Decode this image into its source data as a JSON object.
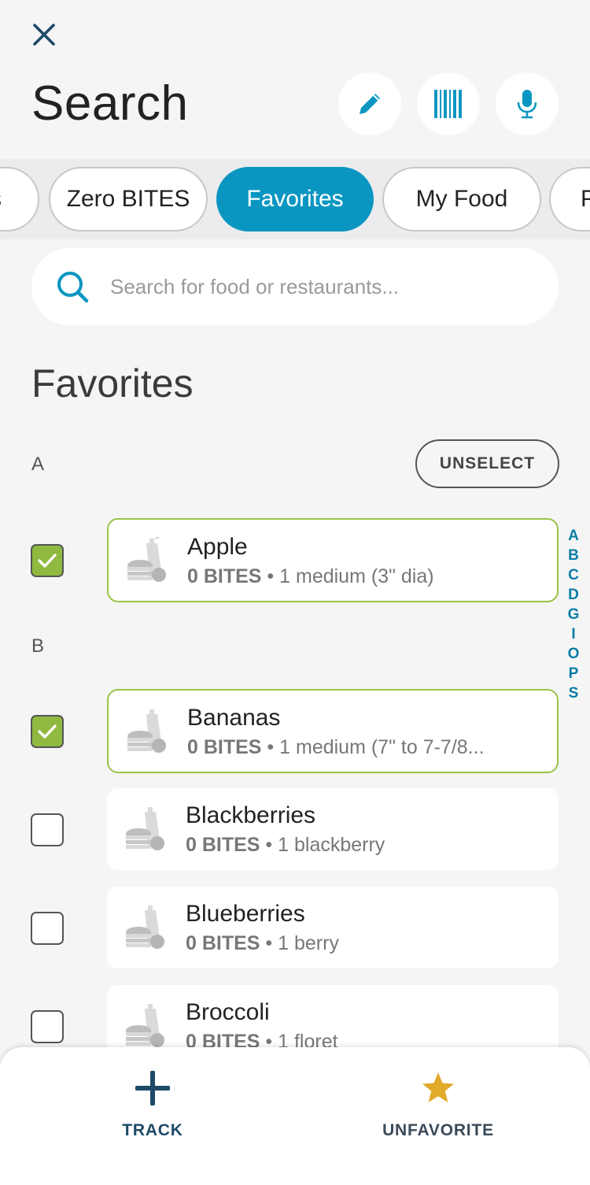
{
  "header": {
    "title": "Search",
    "close_icon": "close-icon",
    "actions": [
      {
        "name": "edit",
        "icon": "pencil-icon"
      },
      {
        "name": "barcode",
        "icon": "barcode-icon"
      },
      {
        "name": "voice",
        "icon": "microphone-icon"
      }
    ]
  },
  "tabs": [
    {
      "label": "s",
      "active": false
    },
    {
      "label": "Zero BITES",
      "active": false
    },
    {
      "label": "Favorites",
      "active": true
    },
    {
      "label": "My Food",
      "active": false
    },
    {
      "label": "P",
      "active": false
    }
  ],
  "search": {
    "placeholder": "Search for food or restaurants...",
    "value": ""
  },
  "section": {
    "title": "Favorites",
    "unselect_label": "UNSELECT"
  },
  "groups": [
    {
      "letter": "A",
      "items": [
        {
          "name": "Apple",
          "bites": "0 BITES",
          "sep": " • ",
          "serving": "1 medium (3\" dia)",
          "checked": true
        }
      ]
    },
    {
      "letter": "B",
      "items": [
        {
          "name": "Bananas",
          "bites": "0 BITES",
          "sep": " • ",
          "serving": "1 medium (7\" to 7-7/8...",
          "checked": true
        },
        {
          "name": "Blackberries",
          "bites": "0 BITES",
          "sep": " • ",
          "serving": "1 blackberry",
          "checked": false
        },
        {
          "name": "Blueberries",
          "bites": "0 BITES",
          "sep": " • ",
          "serving": "1 berry",
          "checked": false
        },
        {
          "name": "Broccoli",
          "bites": "0 BITES",
          "sep": " • ",
          "serving": "1 floret",
          "checked": false
        }
      ]
    }
  ],
  "alpha_index": [
    "A",
    "B",
    "C",
    "D",
    "G",
    "I",
    "O",
    "P",
    "S"
  ],
  "bottom_bar": {
    "track_label": "TRACK",
    "unfavorite_label": "UNFAVORITE"
  },
  "colors": {
    "accent": "#0a96c1",
    "check": "#8fba3f",
    "star": "#e0aa2a",
    "navy": "#1d4a66"
  }
}
